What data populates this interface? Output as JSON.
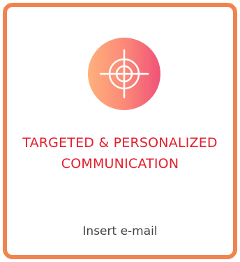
{
  "card": {
    "icon": "target-crosshair-icon",
    "title_line1": "TARGETED & PERSONALIZED",
    "title_line2": "COMMUNICATION",
    "cta": "Insert e-mail"
  },
  "colors": {
    "border": "#f0844f",
    "title": "#e3202e",
    "icon_gradient_start": "#ffb07c",
    "icon_gradient_end": "#f05278",
    "cta_text": "#444444"
  }
}
